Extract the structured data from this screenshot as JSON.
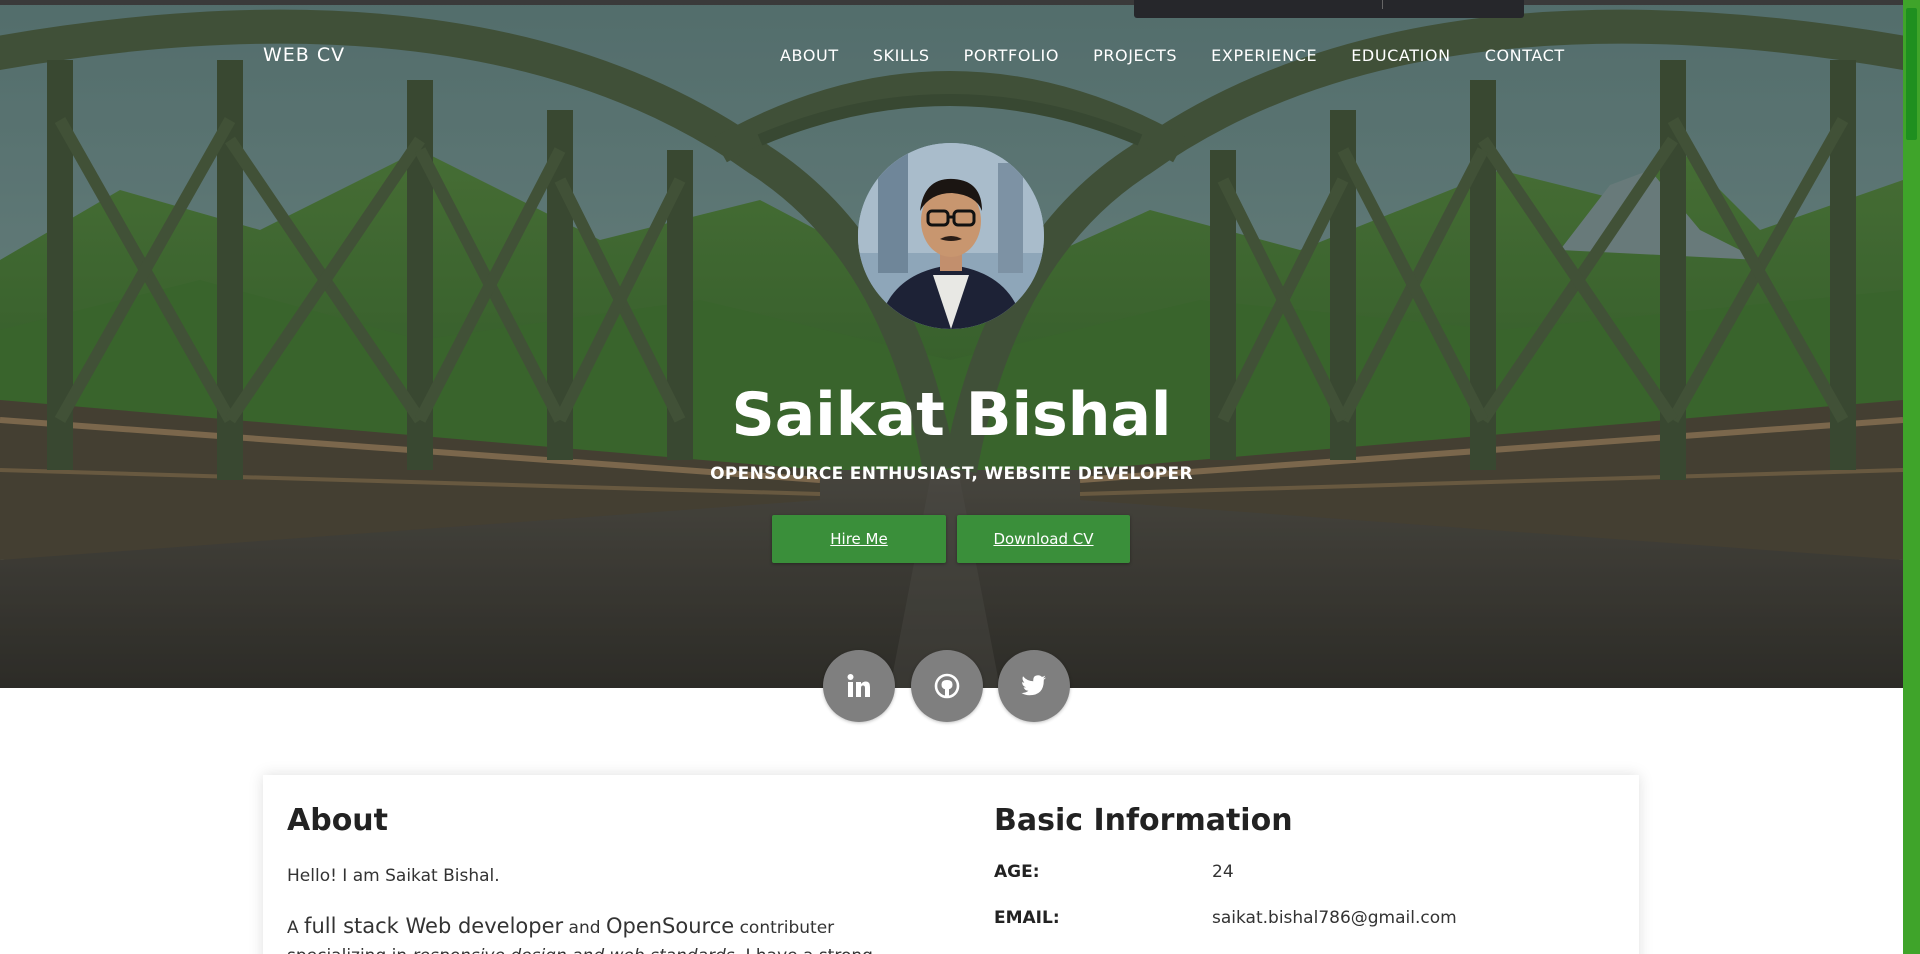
{
  "nav": {
    "brand": "WEB CV",
    "items": [
      "ABOUT",
      "SKILLS",
      "PORTFOLIO",
      "PROJECTS",
      "EXPERIENCE",
      "EDUCATION",
      "CONTACT"
    ]
  },
  "hero": {
    "name": "Saikat Bishal",
    "tagline": "OPENSOURCE ENTHUSIAST, WEBSITE DEVELOPER",
    "hire_label": "Hire Me",
    "download_label": "Download CV"
  },
  "social": [
    {
      "name": "linkedin-icon"
    },
    {
      "name": "github-icon"
    },
    {
      "name": "twitter-icon"
    }
  ],
  "about": {
    "title": "About",
    "greeting": "Hello! I am Saikat Bishal.",
    "p2_a": "A ",
    "p2_b": "full stack Web developer",
    "p2_c": " and ",
    "p2_d": "OpenSource",
    "p2_e": " contributer",
    "p2_f": "specializing in ",
    "p2_g": "responsive design and web standards",
    "p2_h": ". I have a strong"
  },
  "basic_info": {
    "title": "Basic Information",
    "rows": [
      {
        "key": "AGE:",
        "value": "24"
      },
      {
        "key": "EMAIL:",
        "value": "saikat.bishal786@gmail.com"
      }
    ]
  },
  "colors": {
    "accent": "#3a8f3a",
    "scrollbar": "#3fa42a",
    "social_bg": "#7f7f7f"
  }
}
